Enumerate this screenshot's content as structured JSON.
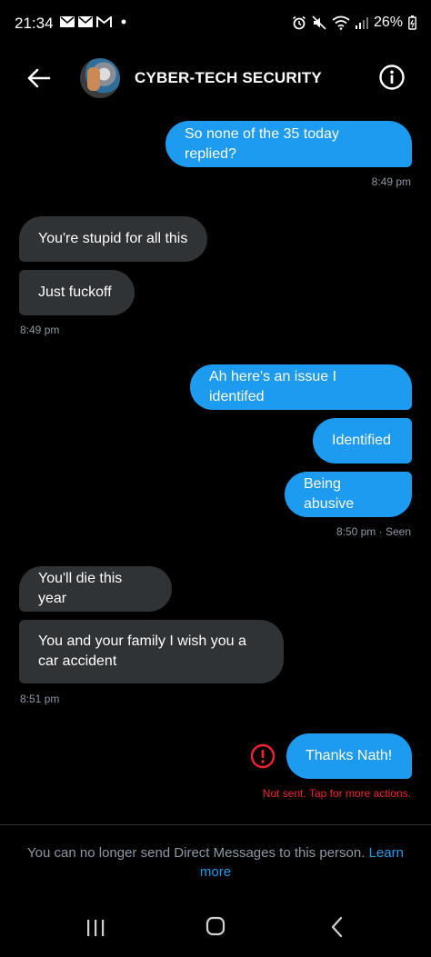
{
  "status_bar": {
    "time": "21:34",
    "battery": "26%",
    "icons": [
      "mail-icon",
      "mail-icon",
      "gmail-icon",
      "dot-icon",
      "alarm-icon",
      "mute-icon",
      "wifi-icon",
      "signal-icon",
      "battery-icon"
    ]
  },
  "header": {
    "title": "CYBER-TECH SECURITY",
    "back_icon": "arrow-left-icon",
    "info_icon": "info-icon"
  },
  "messages": [
    {
      "direction": "out",
      "text": "So none of the 35 today replied?"
    },
    {
      "direction": "in",
      "text": "You're stupid for all this"
    },
    {
      "direction": "in",
      "text": "Just fuckoff"
    },
    {
      "direction": "out",
      "text": "Ah here's an issue I identifed"
    },
    {
      "direction": "out",
      "text": "Identified"
    },
    {
      "direction": "out",
      "text": "Being abusive"
    },
    {
      "direction": "in",
      "text": "You'll die this year"
    },
    {
      "direction": "in",
      "text": "You and your family I wish you a car accident"
    },
    {
      "direction": "out",
      "text": "Thanks Nath!"
    }
  ],
  "timestamps": {
    "t1": "8:49 pm",
    "t2": "8:49 pm",
    "t3": "8:50 pm · Seen",
    "t4": "8:51 pm"
  },
  "error": {
    "text": "Not sent. Tap for more actions.",
    "color": "#f4212e"
  },
  "footer": {
    "notice": "You can no longer send Direct Messages to this person.",
    "link": "Learn more"
  },
  "colors": {
    "accent": "#1d9bf0",
    "incoming_bubble": "#2f3336",
    "muted_text": "#8b98a5",
    "background": "#000000"
  }
}
